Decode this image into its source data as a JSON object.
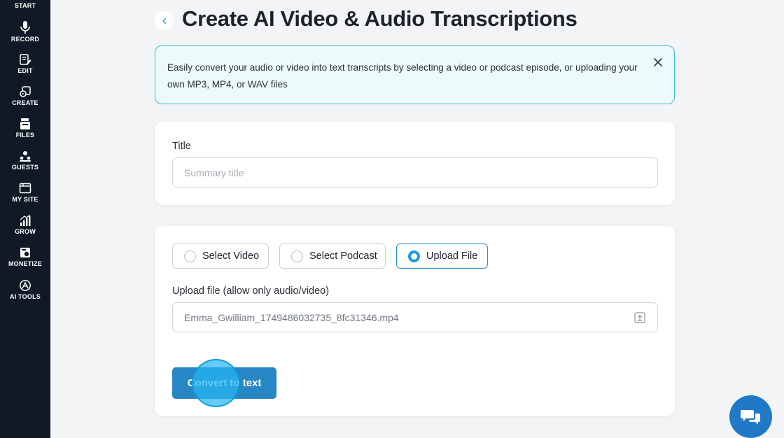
{
  "sidebar": {
    "items": [
      {
        "label": "START",
        "icon": "start-icon"
      },
      {
        "label": "RECORD",
        "icon": "microphone-icon"
      },
      {
        "label": "EDIT",
        "icon": "edit-icon"
      },
      {
        "label": "CREATE",
        "icon": "create-icon"
      },
      {
        "label": "FILES",
        "icon": "files-icon"
      },
      {
        "label": "GUESTS",
        "icon": "guests-icon"
      },
      {
        "label": "MY SITE",
        "icon": "site-icon"
      },
      {
        "label": "GROW",
        "icon": "grow-icon"
      },
      {
        "label": "MONETIZE",
        "icon": "monetize-icon"
      },
      {
        "label": "AI TOOLS",
        "icon": "ai-tools-icon"
      }
    ]
  },
  "header": {
    "title": "Create AI Video & Audio Transcriptions"
  },
  "banner": {
    "text": "Easily convert your audio or video into text transcripts by selecting a video or podcast episode, or uploading your own MP3, MP4, or WAV files"
  },
  "title_card": {
    "label": "Title",
    "placeholder": "Summary title",
    "value": ""
  },
  "upload_card": {
    "options": [
      {
        "label": "Select Video",
        "selected": false
      },
      {
        "label": "Select Podcast",
        "selected": false
      },
      {
        "label": "Upload File",
        "selected": true
      }
    ],
    "file_label": "Upload file (allow only audio/video)",
    "file_name": "Emma_Gwilliam_1749486032735_8fc31346.mp4",
    "convert_label": "Convert to text"
  },
  "colors": {
    "sidebar_bg": "#0f1a26",
    "accent": "#2786c4",
    "banner_bg": "#ecfafa",
    "banner_border": "#3bbdcf"
  }
}
